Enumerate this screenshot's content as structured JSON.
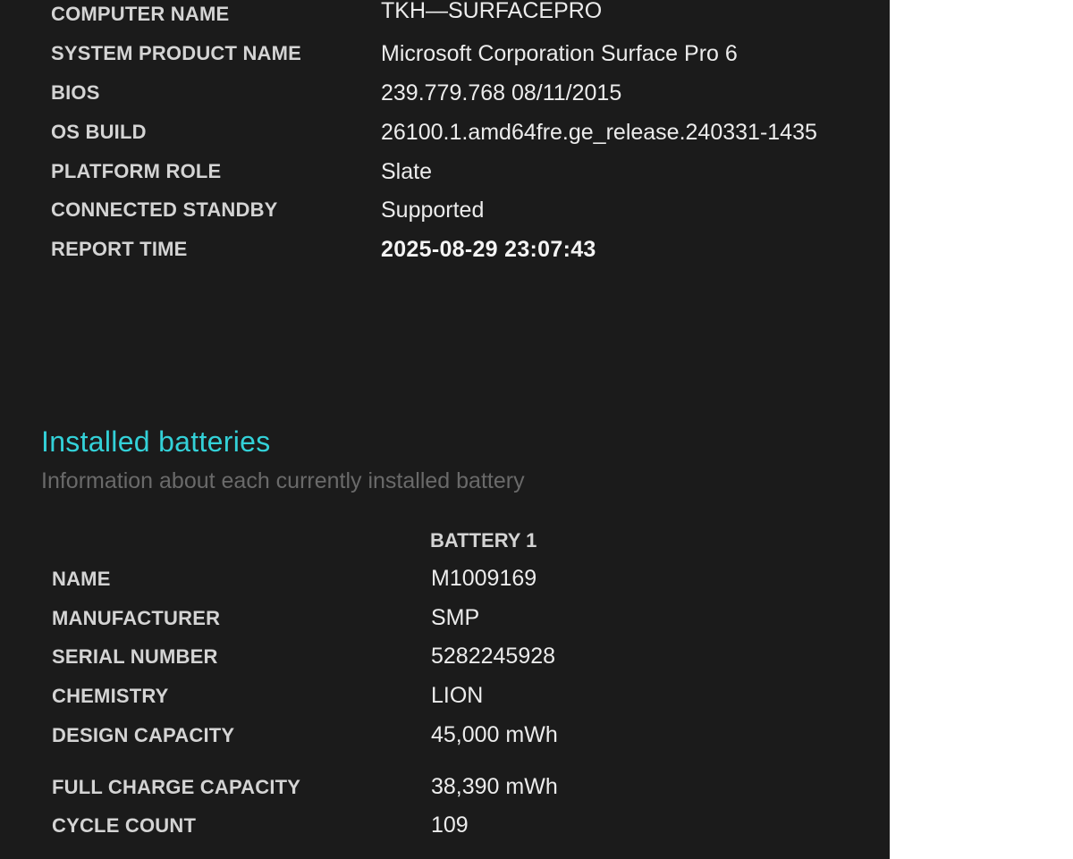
{
  "system_info": {
    "rows": [
      {
        "label": "COMPUTER NAME",
        "value": "TKH—SURFACEPRO"
      },
      {
        "label": "SYSTEM PRODUCT NAME",
        "value": "Microsoft Corporation Surface Pro 6"
      },
      {
        "label": "BIOS",
        "value": "239.779.768 08/11/2015"
      },
      {
        "label": "OS BUILD",
        "value": "26100.1.amd64fre.ge_release.240331-1435"
      },
      {
        "label": "PLATFORM ROLE",
        "value": "Slate"
      },
      {
        "label": "CONNECTED STANDBY",
        "value": "Supported"
      },
      {
        "label": "REPORT TIME",
        "value": "2025-08-29  23:07:43"
      }
    ]
  },
  "installed_batteries": {
    "title": "Installed batteries",
    "subtitle": "Information about each currently installed battery",
    "column_header": "BATTERY 1",
    "rows": [
      {
        "label": "NAME",
        "value": "M1009169"
      },
      {
        "label": "MANUFACTURER",
        "value": "SMP"
      },
      {
        "label": "SERIAL NUMBER",
        "value": "5282245928"
      },
      {
        "label": "CHEMISTRY",
        "value": "LION"
      },
      {
        "label": "DESIGN CAPACITY",
        "value": "45,000 mWh"
      },
      {
        "label": "FULL CHARGE CAPACITY",
        "value": "38,390 mWh"
      },
      {
        "label": "CYCLE COUNT",
        "value": "109"
      }
    ]
  },
  "colors": {
    "background": "#1b1b1b",
    "section_title": "#33d1d8",
    "subtitle": "#6a6a6a",
    "page_margin": "#ffffff"
  }
}
